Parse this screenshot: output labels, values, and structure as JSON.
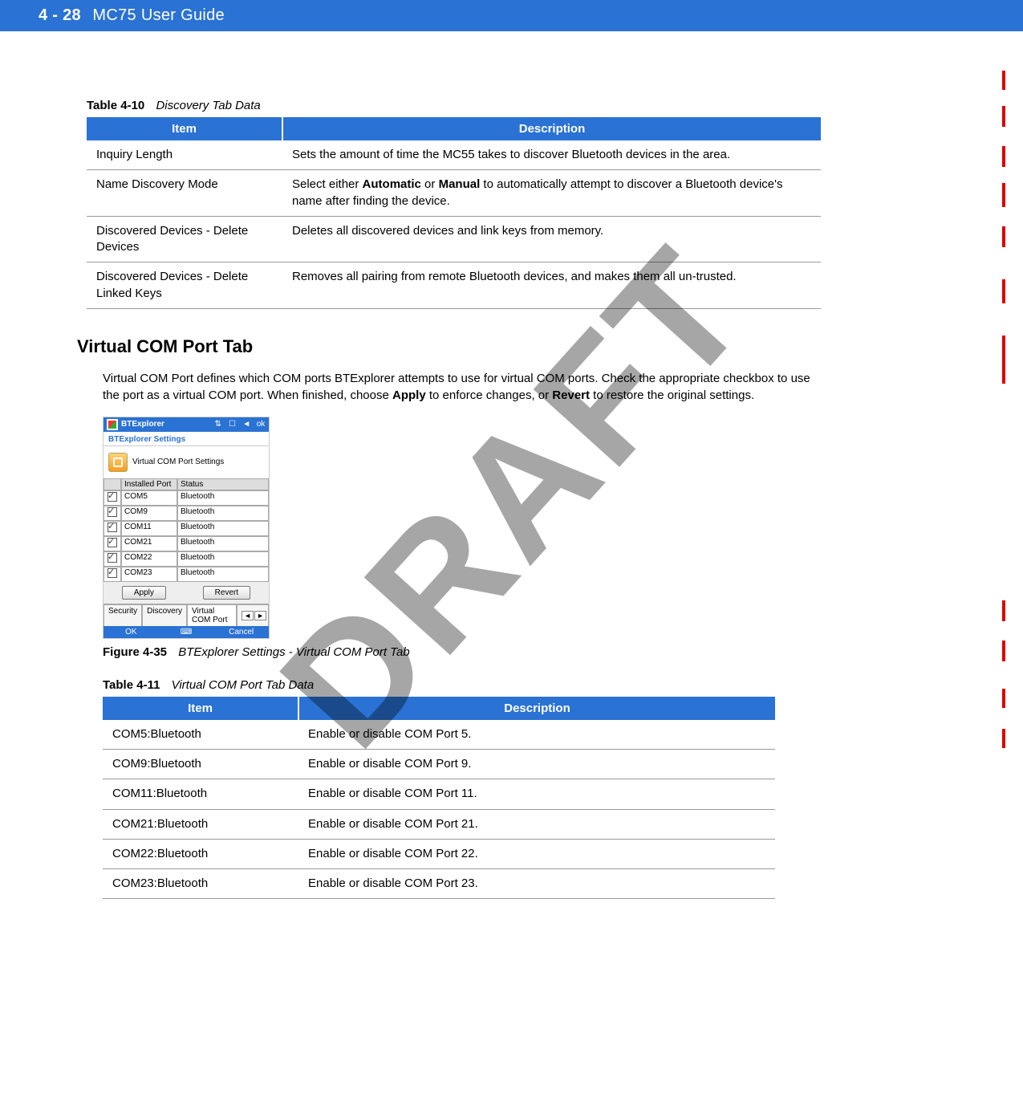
{
  "header": {
    "page_number": "4 - 28",
    "guide_title": "MC75 User Guide"
  },
  "watermark": "DRAFT",
  "table10": {
    "label": "Table 4-10",
    "title": "Discovery Tab Data",
    "columns": [
      "Item",
      "Description"
    ],
    "rows": [
      {
        "item": "Inquiry Length",
        "desc": "Sets the amount of time the MC55 takes to discover Bluetooth devices in the area."
      },
      {
        "item": "Name Discovery Mode",
        "desc_pre": "Select either ",
        "bold1": "Automatic",
        "mid1": " or ",
        "bold2": "Manual",
        "desc_post": " to automatically attempt to discover a Bluetooth device's name after finding the device."
      },
      {
        "item": "Discovered Devices - Delete Devices",
        "desc": "Deletes all discovered devices and link keys from memory."
      },
      {
        "item": "Discovered Devices - Delete Linked Keys",
        "desc": "Removes all pairing from remote Bluetooth devices, and makes them all un-trusted."
      }
    ]
  },
  "section": {
    "heading": "Virtual COM Port Tab",
    "para_pre": "Virtual COM Port defines which COM ports BTExplorer attempts to use for virtual COM ports. Check the appropriate checkbox to use the port as a virtual COM port. When finished, choose ",
    "para_bold1": "Apply",
    "para_mid1": " to enforce changes, or ",
    "para_bold2": "Revert",
    "para_post": " to restore the original settings."
  },
  "screenshot": {
    "title": "BTExplorer",
    "titlebar_icons": {
      "signal": "⇅",
      "doc": "☐",
      "sound": "◄",
      "ok": "ok"
    },
    "subtitle": "BTExplorer Settings",
    "section_label": "Virtual COM Port Settings",
    "grid_headers": {
      "port": "Installed Port",
      "status": "Status"
    },
    "rows": [
      {
        "checked": true,
        "port": "COM5",
        "status": "Bluetooth"
      },
      {
        "checked": true,
        "port": "COM9",
        "status": "Bluetooth"
      },
      {
        "checked": true,
        "port": "COM11",
        "status": "Bluetooth"
      },
      {
        "checked": true,
        "port": "COM21",
        "status": "Bluetooth"
      },
      {
        "checked": true,
        "port": "COM22",
        "status": "Bluetooth"
      },
      {
        "checked": true,
        "port": "COM23",
        "status": "Bluetooth"
      }
    ],
    "buttons": {
      "apply": "Apply",
      "revert": "Revert"
    },
    "tabs": {
      "security": "Security",
      "discovery": "Discovery",
      "vcom": "Virtual COM Port",
      "left": "◄",
      "right": "►"
    },
    "bottom": {
      "ok": "OK",
      "keyboard": "⌨",
      "cancel": "Cancel"
    }
  },
  "figure35": {
    "label": "Figure 4-35",
    "title": "BTExplorer Settings - Virtual COM Port Tab"
  },
  "table11": {
    "label": "Table 4-11",
    "title": "Virtual COM Port Tab Data",
    "columns": [
      "Item",
      "Description"
    ],
    "rows": [
      {
        "item": "COM5:Bluetooth",
        "desc": "Enable or disable COM Port 5."
      },
      {
        "item": "COM9:Bluetooth",
        "desc": "Enable or disable COM Port 9."
      },
      {
        "item": "COM11:Bluetooth",
        "desc": "Enable or disable COM Port 11."
      },
      {
        "item": "COM21:Bluetooth",
        "desc": "Enable or disable COM Port 21."
      },
      {
        "item": "COM22:Bluetooth",
        "desc": "Enable or disable COM Port 22."
      },
      {
        "item": "COM23:Bluetooth",
        "desc": "Enable or disable COM Port 23."
      }
    ]
  }
}
